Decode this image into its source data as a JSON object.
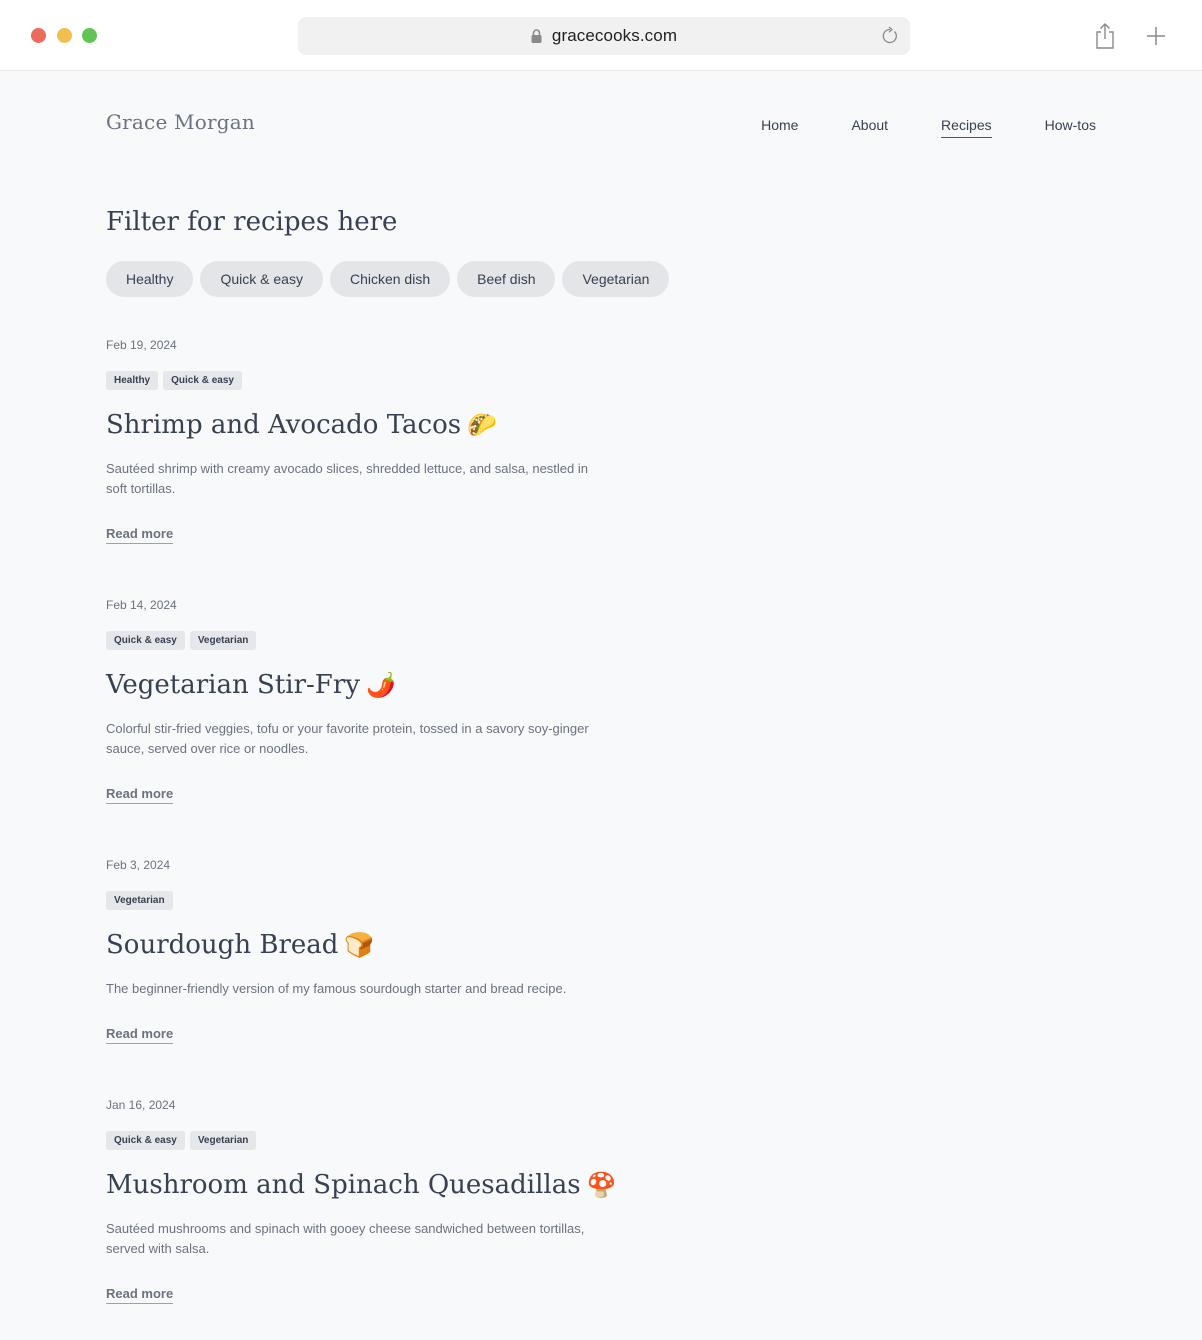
{
  "browser": {
    "url": "gracecooks.com",
    "icons": {
      "lock": "lock-icon",
      "reload": "reload-icon",
      "share": "share-icon",
      "new_tab": "plus-icon"
    }
  },
  "site": {
    "logo": "Grace Morgan",
    "nav": [
      {
        "label": "Home",
        "active": false
      },
      {
        "label": "About",
        "active": false
      },
      {
        "label": "Recipes",
        "active": true
      },
      {
        "label": "How-tos",
        "active": false
      }
    ]
  },
  "filters": {
    "title": "Filter for recipes here",
    "chips": [
      "Healthy",
      "Quick & easy",
      "Chicken dish",
      "Beef dish",
      "Vegetarian"
    ]
  },
  "posts": [
    {
      "date": "Feb 19, 2024",
      "tags": [
        "Healthy",
        "Quick & easy"
      ],
      "title": "Shrimp and Avocado Tacos",
      "emoji": "🌮",
      "description": "Sautéed shrimp with creamy avocado slices, shredded lettuce, and salsa, nestled in soft tortillas.",
      "link": "Read more"
    },
    {
      "date": "Feb 14, 2024",
      "tags": [
        "Quick & easy",
        "Vegetarian"
      ],
      "title": "Vegetarian Stir-Fry",
      "emoji": "🌶️",
      "description": "Colorful stir-fried veggies, tofu or your favorite protein, tossed in a savory soy-ginger sauce, served over rice or noodles.",
      "link": "Read more"
    },
    {
      "date": "Feb 3, 2024",
      "tags": [
        "Vegetarian"
      ],
      "title": "Sourdough Bread",
      "emoji": "🍞",
      "description": "The beginner-friendly version of my famous sourdough starter and bread recipe.",
      "link": "Read more"
    },
    {
      "date": "Jan 16, 2024",
      "tags": [
        "Quick & easy",
        "Vegetarian"
      ],
      "title": "Mushroom and Spinach Quesadillas",
      "emoji": "🍄",
      "description": "Sautéed mushrooms and spinach with gooey cheese sandwiched between tortillas, served with salsa.",
      "link": "Read more"
    }
  ]
}
